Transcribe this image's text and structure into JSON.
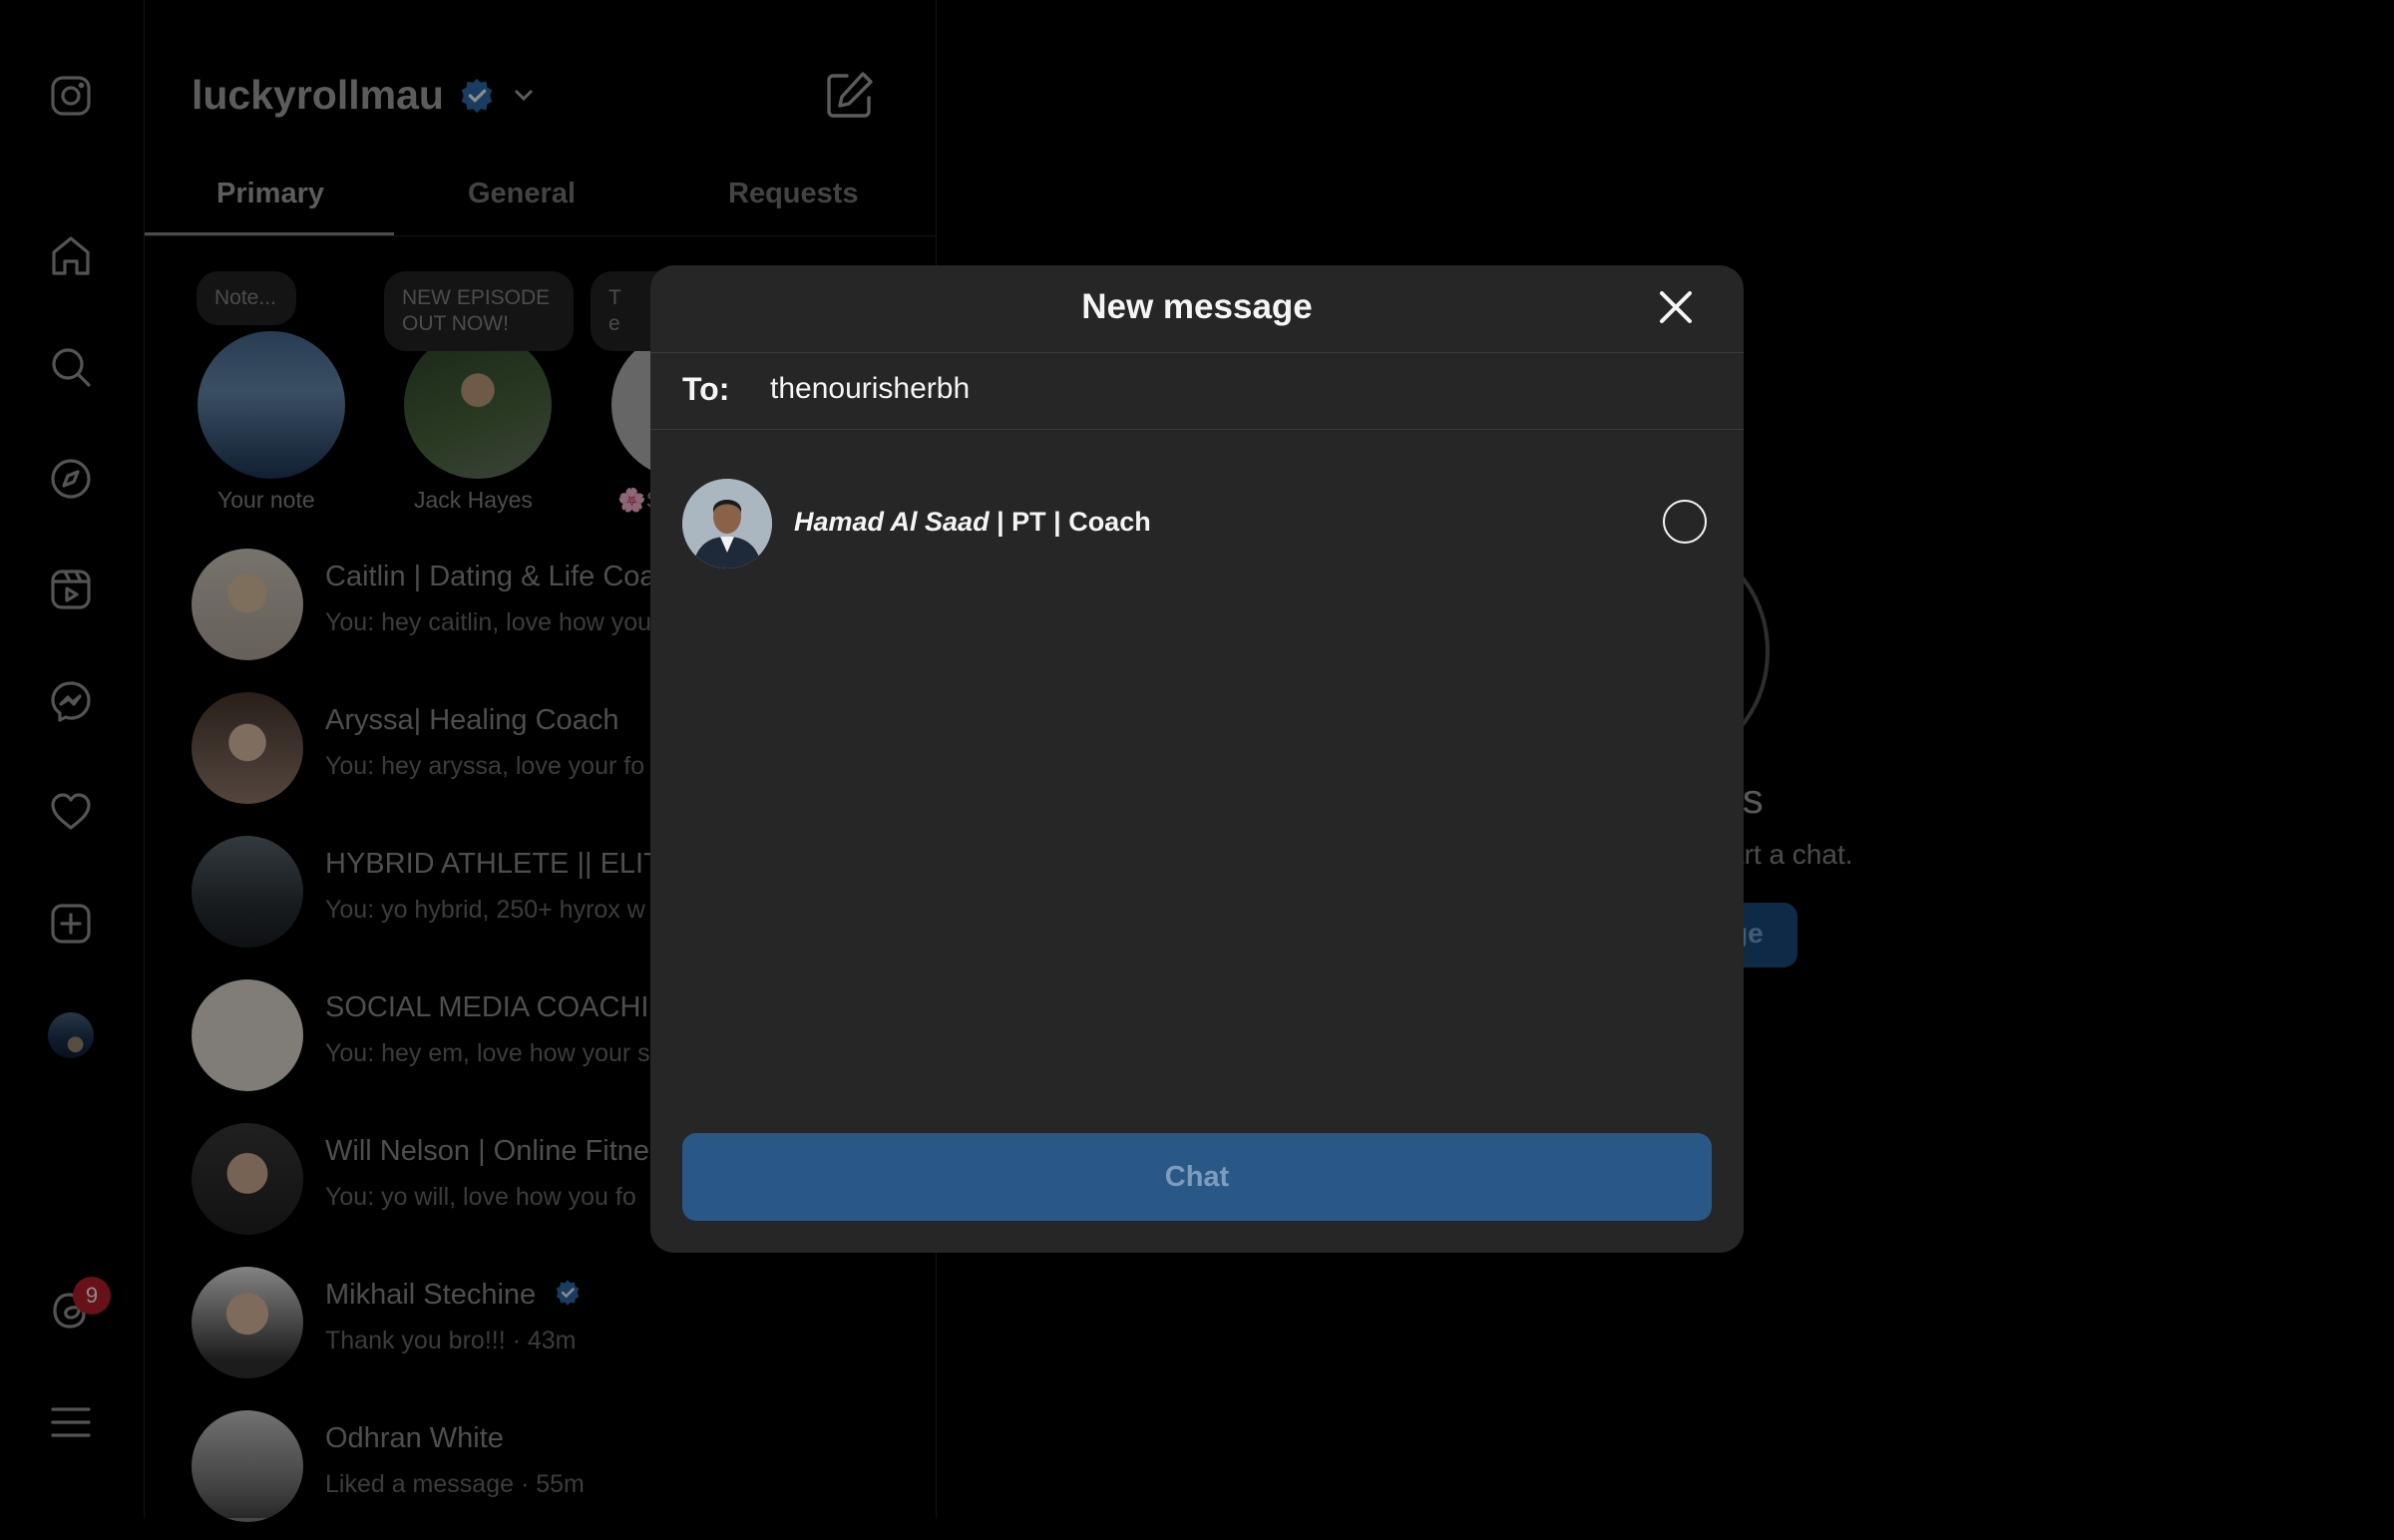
{
  "account": {
    "username": "luckyrollmau"
  },
  "tabs": [
    {
      "label": "Primary",
      "active": true
    },
    {
      "label": "General",
      "active": false
    },
    {
      "label": "Requests",
      "active": false
    }
  ],
  "notes": [
    {
      "bubble": "Note...",
      "label": "Your note"
    },
    {
      "bubble": "NEW EPISODE\nOUT NOW!",
      "label": "Jack Hayes"
    },
    {
      "bubble": "T\ne",
      "label": "🌸S"
    }
  ],
  "conversations": [
    {
      "name": "Caitlin | Dating & Life Coa",
      "preview": "You: hey caitlin, love how you"
    },
    {
      "name": "Aryssa| Healing Coach",
      "preview": "You: hey aryssa, love your fo"
    },
    {
      "name": "HYBRID ATHLETE || ELITE",
      "preview": "You: yo hybrid, 250+ hyrox w"
    },
    {
      "name": "SOCIAL MEDIA COACHIN",
      "preview": "You: hey em, love how your s"
    },
    {
      "name": "Will Nelson | Online Fitnes",
      "preview": "You: yo will, love how you fo"
    },
    {
      "name": "Mikhail Stechine",
      "preview": "Thank you bro!!! · 43m",
      "verified": true
    },
    {
      "name": "Odhran White",
      "preview": "Liked a message · 55m"
    }
  ],
  "notifications": {
    "count": "9"
  },
  "main": {
    "title_fragment": "ges",
    "subtitle_fragment": "art a chat.",
    "button_fragment": "ge"
  },
  "modal": {
    "title": "New message",
    "to_label": "To:",
    "to_value": "thenourisherbh",
    "result": {
      "name_italic": "Hamad Al Saad",
      "name_rest": " | PT | Coach",
      "selected": false
    },
    "chat_button": "Chat"
  },
  "colors": {
    "verified_blue": "#3897f0",
    "badge_red": "#c0202c",
    "chat_button_disabled": "#2a5886"
  },
  "icons": [
    "instagram-icon",
    "home-icon",
    "search-icon",
    "explore-icon",
    "reels-icon",
    "messenger-icon",
    "heart-icon",
    "create-icon",
    "threads-icon",
    "menu-icon",
    "compose-icon",
    "close-icon"
  ]
}
